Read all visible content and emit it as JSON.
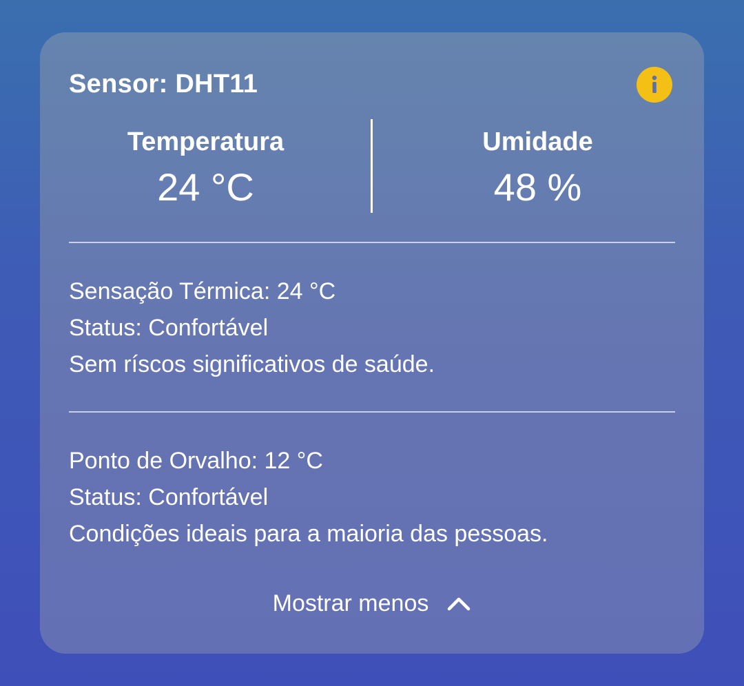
{
  "sensor": {
    "title": "Sensor: DHT11",
    "info_icon": "info-icon",
    "info_icon_color": "#f5c016"
  },
  "readings": {
    "temperature": {
      "label": "Temperatura",
      "value": "24 °C"
    },
    "humidity": {
      "label": "Umidade",
      "value": "48 %"
    }
  },
  "heat_index": {
    "line1": "Sensação Térmica: 24 °C",
    "line2": "Status: Confortável",
    "line3": "Sem ríscos significativos de saúde."
  },
  "dew_point": {
    "line1": "Ponto de Orvalho: 12 °C",
    "line2": "Status: Confortável",
    "line3": "Condições ideais para a maioria das pessoas."
  },
  "toggle": {
    "label": "Mostrar menos",
    "icon": "chevron-up-icon"
  }
}
